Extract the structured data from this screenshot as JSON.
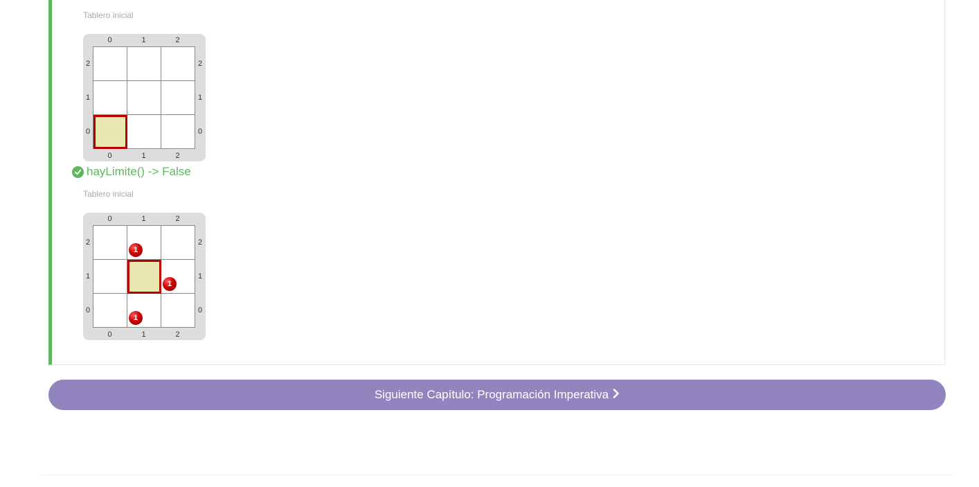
{
  "boards": [
    {
      "label": "Tablero inicial",
      "cols": [
        "0",
        "1",
        "2"
      ],
      "rows": [
        "2",
        "1",
        "0"
      ],
      "head": {
        "col": 0,
        "row": 0
      },
      "balls": []
    },
    {
      "label": "Tablero inicial",
      "cols": [
        "0",
        "1",
        "2"
      ],
      "rows": [
        "2",
        "1",
        "0"
      ],
      "head": {
        "col": 1,
        "row": 1
      },
      "balls": [
        {
          "col": 1,
          "row": 2,
          "color": "red",
          "count": "1"
        },
        {
          "col": 2,
          "row": 1,
          "color": "red",
          "count": "1"
        },
        {
          "col": 1,
          "row": 0,
          "color": "red",
          "count": "1"
        }
      ]
    }
  ],
  "result": {
    "text": "hayLimite() -> False",
    "status": "passed",
    "color": "#5cb85c"
  },
  "next_button": {
    "label": "Siguiente Capítulo: Programación Imperativa",
    "icon": "chevron-right-icon",
    "color": "#9285bf"
  },
  "colors": {
    "accent_border": "#5cb85c",
    "head_fill": "#e8e8b0",
    "head_border": "#b80000",
    "ball": "#cc0000"
  }
}
